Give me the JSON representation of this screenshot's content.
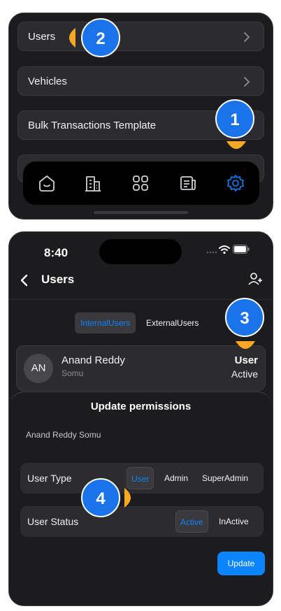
{
  "settings_menu": {
    "items": [
      {
        "label": "Users"
      },
      {
        "label": "Vehicles"
      },
      {
        "label": "Bulk Transactions Template"
      }
    ]
  },
  "tab_bar": {
    "tabs": [
      {
        "icon": "home-icon"
      },
      {
        "icon": "building-icon"
      },
      {
        "icon": "grid-icon"
      },
      {
        "icon": "document-icon"
      },
      {
        "icon": "gear-icon",
        "active": true
      }
    ],
    "active_color": "#0a84ff"
  },
  "annotations": {
    "step1": "1",
    "step2": "2",
    "step3": "3",
    "step4": "4",
    "badge_color": "#1a73e8",
    "pointer_color": "#f9a825"
  },
  "status_bar": {
    "time": "8:40"
  },
  "users_screen": {
    "title": "Users",
    "tabs": {
      "internal": "InternalUsers",
      "external": "ExternalUsers"
    },
    "user": {
      "initials": "AN",
      "name": "Anand Reddy",
      "subtitle": "Somu",
      "role": "User",
      "status": "Active"
    }
  },
  "sheet": {
    "title": "Update permissions",
    "user_full": "Anand Reddy  Somu",
    "user_type": {
      "label": "User Type",
      "options": [
        "User",
        "Admin",
        "SuperAdmin"
      ],
      "selected": "User"
    },
    "user_status": {
      "label": "User Status",
      "options": [
        "Active",
        "InActive"
      ],
      "selected": "Active"
    },
    "update_label": "Update"
  }
}
